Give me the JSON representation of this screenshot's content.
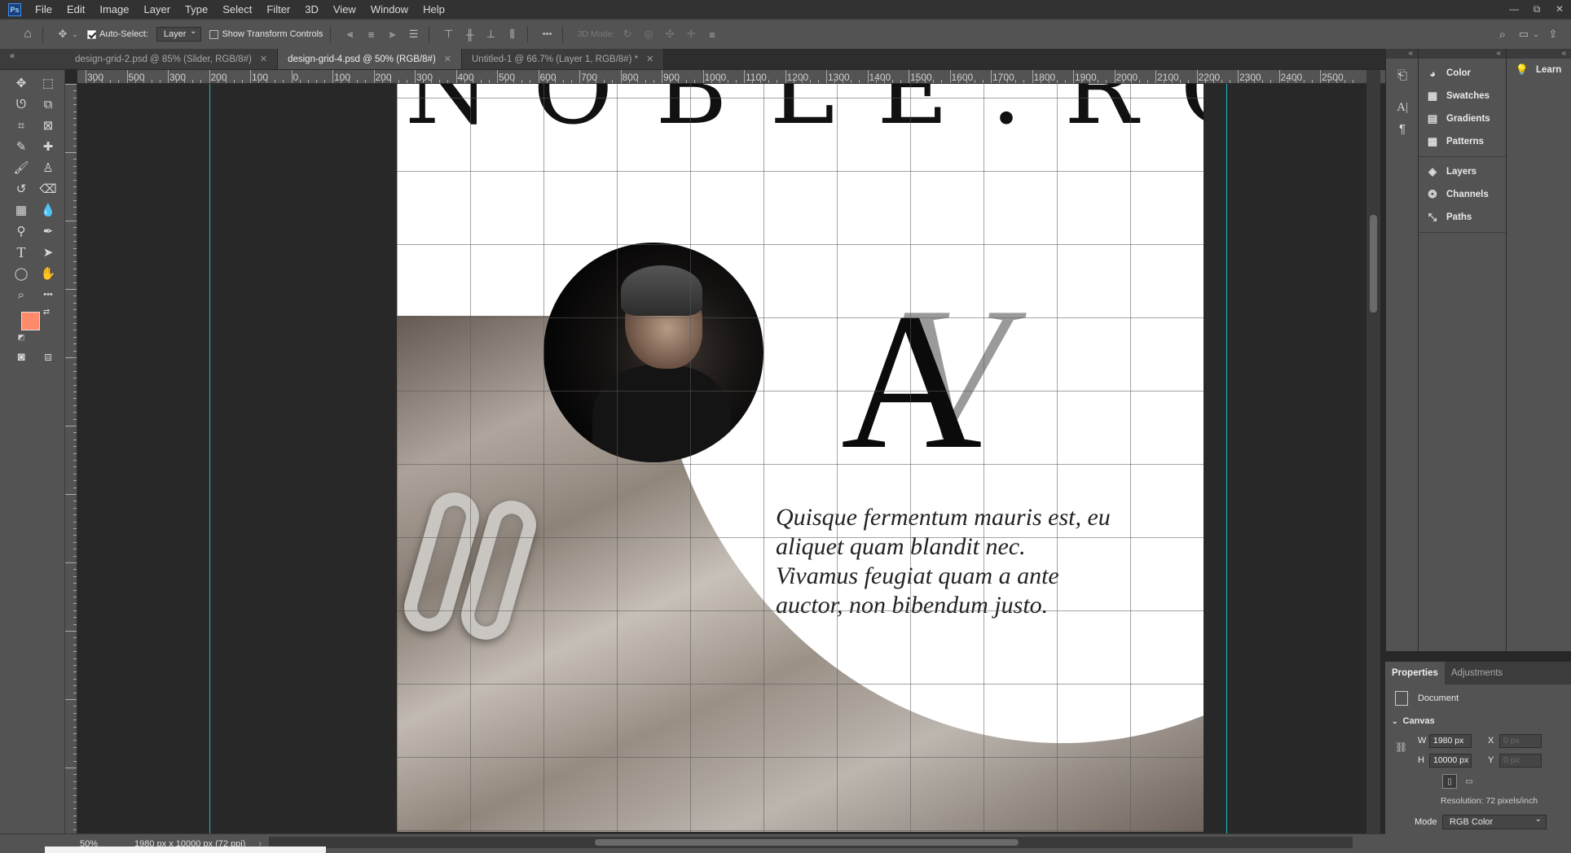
{
  "app": {
    "logo": "Ps"
  },
  "menu": [
    "File",
    "Edit",
    "Image",
    "Layer",
    "Type",
    "Select",
    "Filter",
    "3D",
    "View",
    "Window",
    "Help"
  ],
  "window_controls": {
    "minimize": "—",
    "restore": "⧉",
    "close": "✕"
  },
  "options_bar": {
    "auto_select_label": "Auto-Select:",
    "auto_select_checked": true,
    "auto_select_target": "Layer",
    "show_transform_label": "Show Transform Controls",
    "show_transform_checked": false,
    "mode_3d_label": "3D Mode:",
    "more_label": "•••"
  },
  "tabs": [
    {
      "label": "design-grid-2.psd @ 85% (Slider, RGB/8#)",
      "active": false
    },
    {
      "label": "design-grid-4.psd @ 50% (RGB/8#)",
      "active": true
    },
    {
      "label": "Untitled-1 @ 66.7% (Layer 1, RGB/8#) *",
      "active": false
    }
  ],
  "ruler": {
    "h_labels": [
      "300",
      "500",
      "300",
      "200",
      "100",
      "0",
      "100",
      "200",
      "300",
      "400",
      "500",
      "600",
      "700",
      "800",
      "900",
      "1000",
      "1100",
      "1200",
      "1300",
      "1400",
      "1500",
      "1600",
      "1700",
      "1800",
      "1900",
      "2000",
      "2100",
      "2200",
      "2300",
      "2400",
      "2500"
    ]
  },
  "canvas": {
    "headline": "NOBLE.RO",
    "monogram_a": "A",
    "monogram_v": "V",
    "quote_lines": [
      "Quisque fermentum mauris est, eu",
      "aliquet quam blandit nec.",
      "Vivamus feugiat quam a ante",
      "auctor, non bibendum justo."
    ]
  },
  "panels": {
    "group1": [
      {
        "label": "Color",
        "icon": "color-wheel-icon"
      },
      {
        "label": "Swatches",
        "icon": "swatches-grid-icon"
      },
      {
        "label": "Gradients",
        "icon": "gradient-icon"
      },
      {
        "label": "Patterns",
        "icon": "patterns-icon"
      }
    ],
    "group2": [
      {
        "label": "Layers",
        "icon": "layers-icon"
      },
      {
        "label": "Channels",
        "icon": "channels-icon"
      },
      {
        "label": "Paths",
        "icon": "paths-icon"
      }
    ],
    "learn": "Learn"
  },
  "properties": {
    "tabs": [
      "Properties",
      "Adjustments"
    ],
    "section_document": "Document",
    "section_canvas": "Canvas",
    "w_label": "W",
    "w_value": "1980 px",
    "h_label": "H",
    "h_value": "10000 px",
    "x_label": "X",
    "x_placeholder": "0 px",
    "y_label": "Y",
    "y_placeholder": "0 px",
    "resolution": "Resolution: 72 pixels/inch",
    "mode_label": "Mode",
    "mode_value": "RGB Color"
  },
  "status": {
    "zoom": "50%",
    "doc_info": "1980 px x 10000 px (72 ppi)"
  },
  "colors": {
    "foreground": "#ff8a6b",
    "background": "#ffffff",
    "guide": "#22b9c8"
  }
}
